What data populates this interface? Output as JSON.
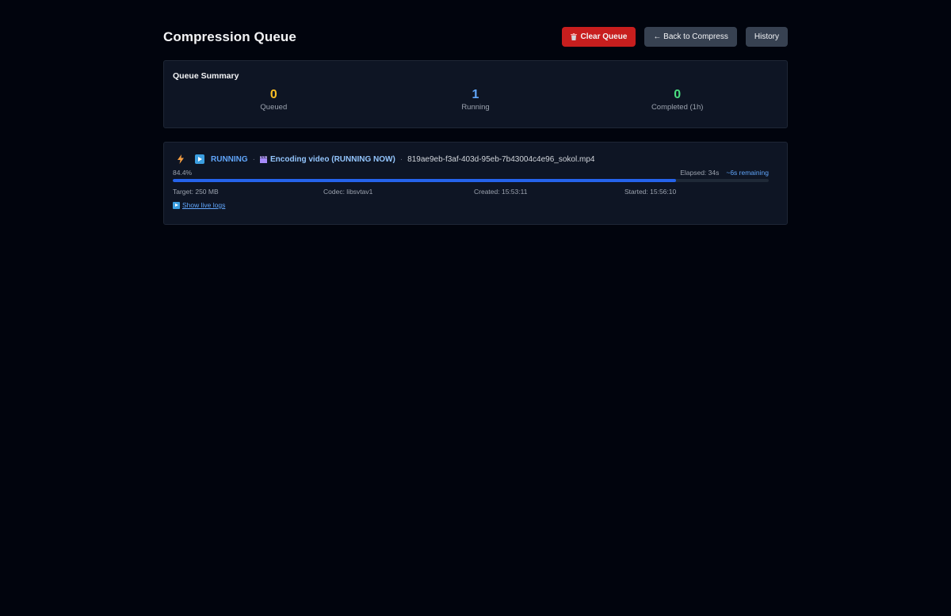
{
  "header": {
    "title": "Compression Queue",
    "clear_label": "Clear Queue",
    "back_label": "← Back to Compress",
    "history_label": "History"
  },
  "summary": {
    "title": "Queue Summary",
    "stats": [
      {
        "value": "0",
        "label": "Queued"
      },
      {
        "value": "1",
        "label": "Running"
      },
      {
        "value": "0",
        "label": "Completed (1h)"
      }
    ]
  },
  "job": {
    "status": "RUNNING",
    "separator": "·",
    "phase": "Encoding video (RUNNING NOW)",
    "filename": "819ae9eb-f3af-403d-95eb-7b43004c4e96_sokol.mp4",
    "progress_label": "84.4%",
    "progress_value": 84.4,
    "elapsed": "Elapsed: 34s",
    "remaining": "~6s remaining",
    "target": "Target: 250 MB",
    "codec": "Codec: libsvtav1",
    "created": "Created: 15:53:11",
    "started": "Started: 15:56:10",
    "logs_label": "Show live logs"
  },
  "colors": {
    "background": "#01040d",
    "card": "#0e1524",
    "danger": "#c81e1e",
    "accent": "#60a5fa",
    "progress": "#2563eb",
    "queued": "#fbbf24",
    "completed": "#4ade80"
  },
  "icons": {
    "clear": "trash-icon",
    "bolt": "lightning-bolt-icon",
    "play": "play-button-icon",
    "phase": "clapperboard-icon",
    "logs": "play-button-icon"
  }
}
